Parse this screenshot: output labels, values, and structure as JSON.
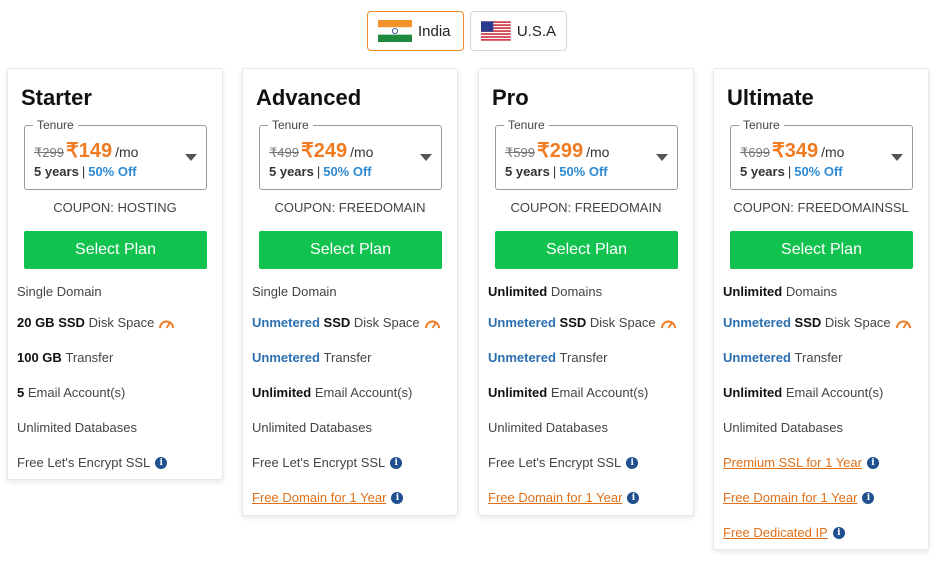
{
  "countries": [
    {
      "label": "India",
      "selected": true
    },
    {
      "label": "U.S.A",
      "selected": false
    }
  ],
  "plans": [
    {
      "name": "Starter",
      "tenure_label": "Tenure",
      "old_price": "₹299",
      "new_price": "₹149",
      "per": "/mo",
      "term": "5 years",
      "discount": "50% Off",
      "coupon": "COUPON: HOSTING",
      "button": "Select Plan",
      "features": {
        "domain": {
          "bold": "",
          "text": "Single Domain"
        },
        "disk": {
          "bold": "20 GB",
          "bold2": "SSD",
          "text": "Disk Space"
        },
        "transfer": {
          "bold": "100 GB",
          "text": "Transfer"
        },
        "email": {
          "bold": "5",
          "text": "Email Account(s)"
        },
        "databases": "Unlimited Databases",
        "ssl": "Free Let's Encrypt SSL"
      }
    },
    {
      "name": "Advanced",
      "tenure_label": "Tenure",
      "old_price": "₹499",
      "new_price": "₹249",
      "per": "/mo",
      "term": "5 years",
      "discount": "50% Off",
      "coupon": "COUPON: FREEDOMAIN",
      "button": "Select Plan",
      "features": {
        "domain": {
          "bold": "",
          "text": "Single Domain"
        },
        "disk": {
          "bold": "Unmetered",
          "bold2": "SSD",
          "text": "Disk Space"
        },
        "transfer": {
          "bold": "Unmetered",
          "text": "Transfer"
        },
        "email": {
          "bold": "Unlimited",
          "text": "Email Account(s)"
        },
        "databases": "Unlimited Databases",
        "ssl": "Free Let's Encrypt SSL",
        "free_domain": "Free Domain for 1 Year"
      }
    },
    {
      "name": "Pro",
      "tenure_label": "Tenure",
      "old_price": "₹599",
      "new_price": "₹299",
      "per": "/mo",
      "term": "5 years",
      "discount": "50% Off",
      "coupon": "COUPON: FREEDOMAIN",
      "button": "Select Plan",
      "features": {
        "domain": {
          "bold": "Unlimited",
          "text": "Domains"
        },
        "disk": {
          "bold": "Unmetered",
          "bold2": "SSD",
          "text": "Disk Space"
        },
        "transfer": {
          "bold": "Unmetered",
          "text": "Transfer"
        },
        "email": {
          "bold": "Unlimited",
          "text": "Email Account(s)"
        },
        "databases": "Unlimited Databases",
        "ssl": "Free Let's Encrypt SSL",
        "free_domain": "Free Domain for 1 Year"
      }
    },
    {
      "name": "Ultimate",
      "tenure_label": "Tenure",
      "old_price": "₹699",
      "new_price": "₹349",
      "per": "/mo",
      "term": "5 years",
      "discount": "50% Off",
      "coupon": "COUPON: FREEDOMAINSSL",
      "button": "Select Plan",
      "features": {
        "domain": {
          "bold": "Unlimited",
          "text": "Domains"
        },
        "disk": {
          "bold": "Unmetered",
          "bold2": "SSD",
          "text": "Disk Space"
        },
        "transfer": {
          "bold": "Unmetered",
          "text": "Transfer"
        },
        "email": {
          "bold": "Unlimited",
          "text": "Email Account(s)"
        },
        "databases": "Unlimited Databases",
        "premium_ssl": "Premium SSL for 1 Year",
        "free_domain": "Free Domain for 1 Year",
        "dedicated_ip": "Free Dedicated IP"
      }
    }
  ],
  "colors": {
    "accent": "#f07b22",
    "button": "#12c24f",
    "discount": "#2d8ad2",
    "unmetered": "#2b6fb0",
    "link": "#e0701a"
  },
  "icons": {
    "gauge": "speed-gauge-icon",
    "info": "info-icon",
    "dropdown": "chevron-down-icon"
  }
}
